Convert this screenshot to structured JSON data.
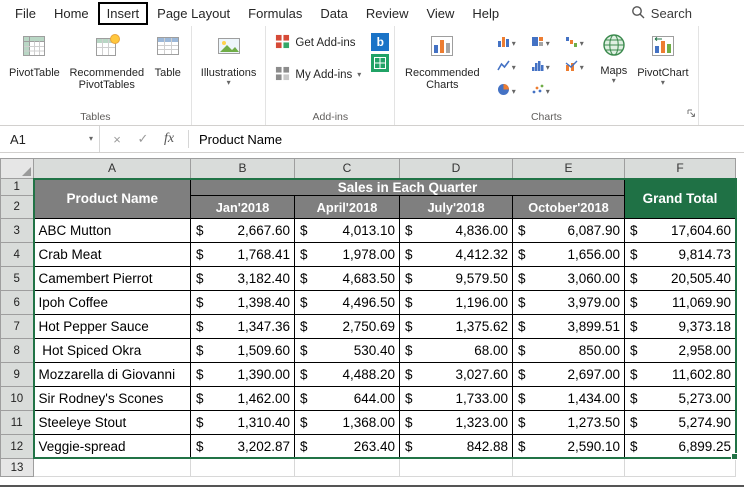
{
  "ribbon": {
    "tabs": [
      "File",
      "Home",
      "Insert",
      "Page Layout",
      "Formulas",
      "Data",
      "Review",
      "View",
      "Help"
    ],
    "active_tab": "Insert",
    "search_label": "Search",
    "groups": {
      "tables": {
        "label": "Tables",
        "pivottable": "PivotTable",
        "recommended_pivottables": "Recommended PivotTables",
        "table": "Table"
      },
      "illustrations": {
        "label": "Illustrations"
      },
      "addins": {
        "label": "Add-ins",
        "get_addins": "Get Add-ins",
        "my_addins": "My Add-ins",
        "bing_letter": "b"
      },
      "charts": {
        "label": "Charts",
        "recommended_charts": "Recommended Charts",
        "maps": "Maps",
        "pivotchart": "PivotChart"
      }
    }
  },
  "formula_bar": {
    "name_box": "A1",
    "fx_label": "fx",
    "formula_value": "Product Name"
  },
  "icons": {
    "caret": "▾",
    "cancel": "×",
    "enter": "✓"
  },
  "sheet": {
    "columns": [
      "A",
      "B",
      "C",
      "D",
      "E",
      "F"
    ],
    "currency": "$",
    "header": {
      "product": "Product Name",
      "sales_title": "Sales in Each Quarter",
      "quarters": [
        "Jan'2018",
        "April'2018",
        "July'2018",
        "October'2018"
      ],
      "grand_total": "Grand Total"
    },
    "header_row_numbers": [
      "1",
      "2"
    ],
    "last_row_number": "13",
    "data": [
      {
        "row": "3",
        "name": "ABC Mutton",
        "values": [
          "2,667.60",
          "4,013.10",
          "4,836.00",
          "6,087.90",
          "17,604.60"
        ]
      },
      {
        "row": "4",
        "name": "Crab Meat",
        "values": [
          "1,768.41",
          "1,978.00",
          "4,412.32",
          "1,656.00",
          "9,814.73"
        ]
      },
      {
        "row": "5",
        "name": "Camembert Pierrot",
        "values": [
          "3,182.40",
          "4,683.50",
          "9,579.50",
          "3,060.00",
          "20,505.40"
        ]
      },
      {
        "row": "6",
        "name": "Ipoh Coffee",
        "values": [
          "1,398.40",
          "4,496.50",
          "1,196.00",
          "3,979.00",
          "11,069.90"
        ]
      },
      {
        "row": "7",
        "name": "Hot Pepper Sauce",
        "values": [
          "1,347.36",
          "2,750.69",
          "1,375.62",
          "3,899.51",
          "9,373.18"
        ]
      },
      {
        "row": "8",
        "name": " Hot Spiced Okra",
        "values": [
          "1,509.60",
          "530.40",
          "68.00",
          "850.00",
          "2,958.00"
        ]
      },
      {
        "row": "9",
        "name": "Mozzarella di Giovanni",
        "values": [
          "1,390.00",
          "4,488.20",
          "3,027.60",
          "2,697.00",
          "11,602.80"
        ]
      },
      {
        "row": "10",
        "name": "Sir Rodney's Scones",
        "values": [
          "1,462.00",
          "644.00",
          "1,733.00",
          "1,434.00",
          "5,273.00"
        ]
      },
      {
        "row": "11",
        "name": "Steeleye Stout",
        "values": [
          "1,310.40",
          "1,368.00",
          "1,323.00",
          "1,273.50",
          "5,274.90"
        ]
      },
      {
        "row": "12",
        "name": "Veggie-spread",
        "values": [
          "3,202.87",
          "263.40",
          "842.88",
          "2,590.10",
          "6,899.25"
        ]
      }
    ]
  },
  "colors": {
    "accent_green": "#217346",
    "header_gray": "#7f7f7f",
    "grand_total_green": "#1f7145"
  }
}
